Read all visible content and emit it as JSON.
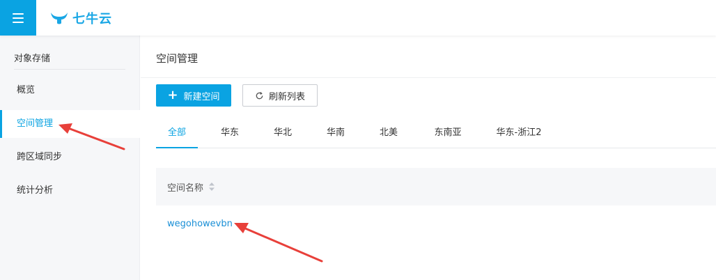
{
  "header": {
    "brand": "七牛云",
    "menu_icon": "hamburger-icon",
    "brand_color": "#0aa3e2"
  },
  "sidebar": {
    "title": "对象存储",
    "items": [
      {
        "label": "概览",
        "active": false
      },
      {
        "label": "空间管理",
        "active": true
      },
      {
        "label": "跨区域同步",
        "active": false
      },
      {
        "label": "统计分析",
        "active": false
      }
    ]
  },
  "main": {
    "title": "空间管理",
    "new_bucket_label": "新建空间",
    "refresh_label": "刷新列表",
    "tabs": [
      {
        "label": "全部",
        "active": true
      },
      {
        "label": "华东",
        "active": false
      },
      {
        "label": "华北",
        "active": false
      },
      {
        "label": "华南",
        "active": false
      },
      {
        "label": "北美",
        "active": false
      },
      {
        "label": "东南亚",
        "active": false
      },
      {
        "label": "华东-浙江2",
        "active": false
      }
    ],
    "table": {
      "column_header": "空间名称",
      "rows": [
        {
          "name": "wegohowevbn"
        }
      ]
    }
  },
  "annotation_color": "#e8403a"
}
